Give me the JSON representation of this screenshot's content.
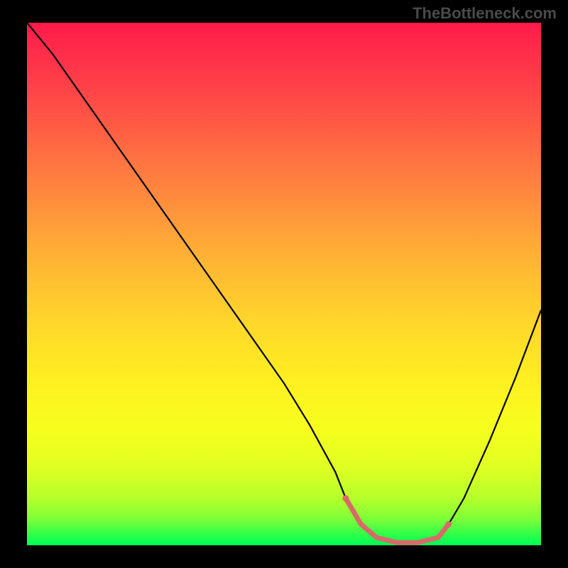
{
  "watermark": "TheBottleneck.com",
  "chart_data": {
    "type": "line",
    "title": "",
    "xlabel": "",
    "ylabel": "",
    "xlim": [
      0,
      100
    ],
    "ylim": [
      0,
      100
    ],
    "series": [
      {
        "name": "bottleneck-curve",
        "x": [
          0,
          5,
          10,
          15,
          20,
          25,
          30,
          35,
          40,
          45,
          50,
          55,
          60,
          62,
          65,
          68,
          72,
          76,
          80,
          82,
          85,
          90,
          95,
          100
        ],
        "y": [
          100,
          94,
          87,
          80,
          73,
          66,
          59,
          52,
          45,
          38,
          31,
          23,
          14,
          9,
          4,
          1.5,
          0.5,
          0.5,
          1.5,
          4,
          9,
          20,
          32,
          45
        ]
      }
    ],
    "highlight": {
      "name": "optimal-segment",
      "color": "#d86a6a",
      "x": [
        62,
        65,
        68,
        72,
        76,
        80,
        82
      ],
      "y": [
        9,
        4,
        1.5,
        0.5,
        0.5,
        1.5,
        4
      ]
    },
    "gradient_stops": [
      {
        "pos": 0,
        "color": "#ff1a4a"
      },
      {
        "pos": 50,
        "color": "#ffd82a"
      },
      {
        "pos": 100,
        "color": "#00ff58"
      }
    ]
  }
}
